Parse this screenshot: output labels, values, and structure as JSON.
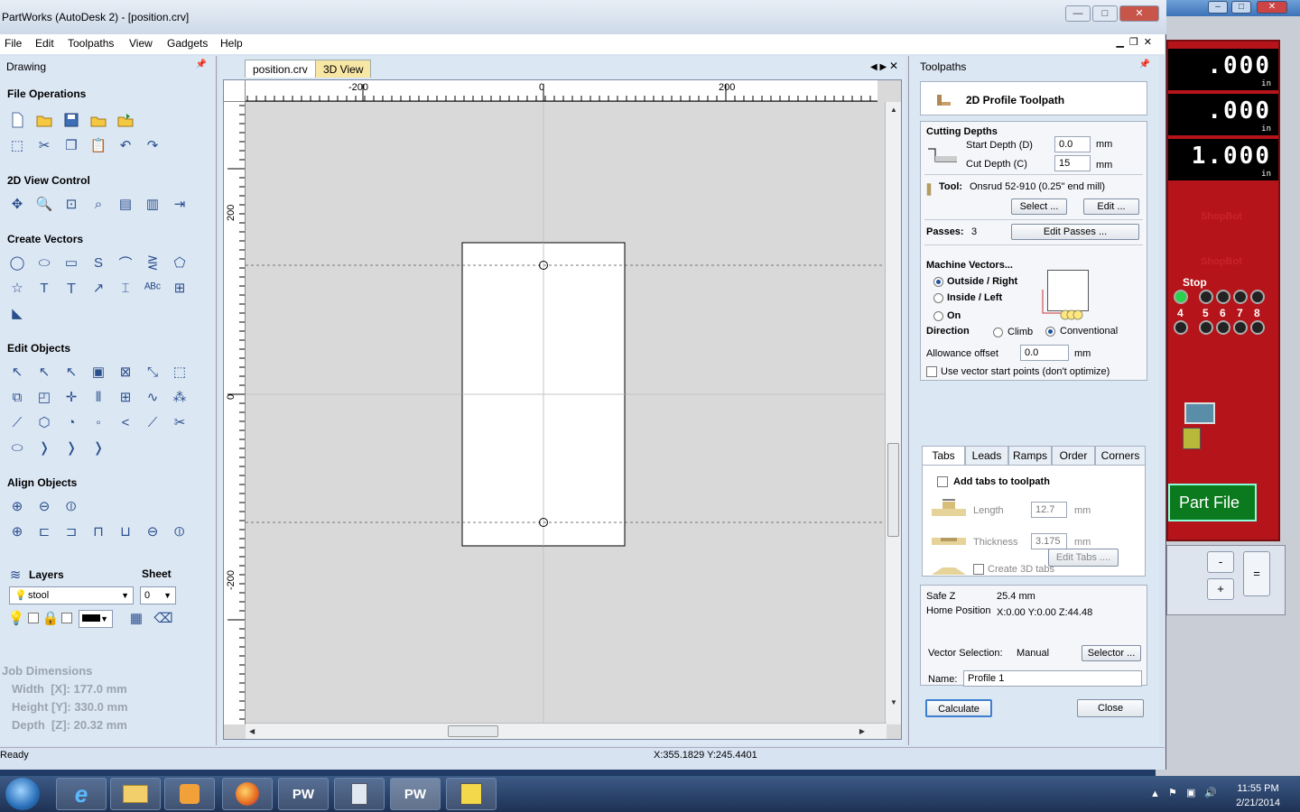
{
  "window": {
    "title": "PartWorks (AutoDesk 2) - [position.crv]",
    "min": "—",
    "max": "□",
    "close": "✕"
  },
  "menu": [
    "File",
    "Edit",
    "Toolpaths",
    "View",
    "Gadgets",
    "Help"
  ],
  "drawing_panel": {
    "title": "Drawing",
    "sections": {
      "file_operations": "File Operations",
      "view_control": "2D View Control",
      "create_vectors": "Create Vectors",
      "edit_objects": "Edit Objects",
      "align_objects": "Align Objects"
    },
    "layers": {
      "title": "Layers",
      "sheet_label": "Sheet",
      "layer_value": "stool",
      "sheet_value": "0"
    },
    "job_dimensions": {
      "title": "Job Dimensions",
      "width": "Width  [X]: 177.0 mm",
      "height": "Height [Y]: 330.0 mm",
      "depth": "Depth  [Z]: 20.32 mm"
    }
  },
  "document": {
    "tabs": [
      "position.crv",
      "3D View"
    ],
    "ruler_top": [
      "-200",
      "0",
      "200"
    ],
    "ruler_left": [
      "200",
      "0",
      "-200"
    ]
  },
  "toolpaths_panel": {
    "title": "Toolpaths",
    "heading": "2D Profile Toolpath",
    "cutting_depths": {
      "title": "Cutting Depths",
      "start_label": "Start Depth (D)",
      "start_value": "0.0",
      "cut_label": "Cut Depth (C)",
      "cut_value": "15",
      "unit": "mm"
    },
    "tool": {
      "label": "Tool:",
      "value": "Onsrud 52-910 (0.25\" end mill)",
      "select": "Select ...",
      "edit": "Edit ..."
    },
    "passes": {
      "label": "Passes:",
      "value": "3",
      "button": "Edit Passes ..."
    },
    "machine_vectors": {
      "title": "Machine Vectors...",
      "outside": "Outside / Right",
      "inside": "Inside / Left",
      "on": "On",
      "direction": "Direction",
      "climb": "Climb",
      "conventional": "Conventional",
      "allowance_label": "Allowance offset",
      "allowance_value": "0.0",
      "allowance_unit": "mm",
      "start_points": "Use vector start points (don't optimize)"
    },
    "subtabs": [
      "Tabs",
      "Leads",
      "Ramps",
      "Order",
      "Corners"
    ],
    "tabs_section": {
      "add": "Add tabs to toolpath",
      "length_label": "Length",
      "length_value": "12.7",
      "thickness_label": "Thickness",
      "thickness_value": "3.175",
      "unit": "mm",
      "create3d": "Create 3D tabs",
      "edit_button": "Edit Tabs ...."
    },
    "safe_z_label": "Safe Z",
    "safe_z_value": "25.4 mm",
    "home_label": "Home Position",
    "home_value": "X:0.00 Y:0.00 Z:44.48",
    "vector_selection_label": "Vector Selection:",
    "vector_selection_value": "Manual",
    "selector_button": "Selector ...",
    "name_label": "Name:",
    "name_value": "Profile 1",
    "calculate": "Calculate",
    "close": "Close"
  },
  "status": {
    "left": "Ready",
    "coords": "X:355.1829 Y:245.4401"
  },
  "shopbot": {
    "readouts": [
      ".000",
      ".000",
      "1.000"
    ],
    "unit": "in",
    "faint1": "ShopBot",
    "faint2": "ShopBot",
    "stop": "Stop",
    "leds": [
      "4",
      "5",
      "6",
      "7",
      "8"
    ],
    "part_file": "Part File",
    "calc": [
      "-",
      "=",
      "+"
    ]
  },
  "taskbar": {
    "time": "11:55 PM",
    "date": "2/21/2014",
    "apps": [
      "IE",
      "Explorer",
      "Media",
      "Firefox",
      "PW3D",
      "Calc",
      "PW",
      "Tool"
    ]
  }
}
